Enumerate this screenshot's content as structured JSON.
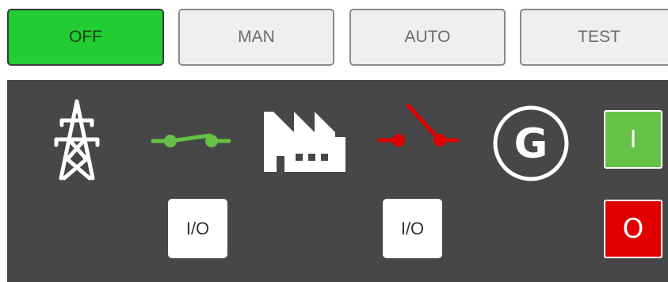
{
  "modes": {
    "off": "OFF",
    "man": "MAN",
    "auto": "AUTO",
    "test": "TEST",
    "active": "OFF"
  },
  "panel": {
    "mains_icon": "power-tower-icon",
    "mains_breaker": {
      "icon": "breaker-closed-icon",
      "state": "closed",
      "color": "#66c247",
      "button_label": "I/O"
    },
    "load_icon": "factory-icon",
    "generator_breaker": {
      "icon": "breaker-open-icon",
      "state": "open",
      "color": "#e00000",
      "button_label": "I/O"
    },
    "generator": {
      "icon": "generator-icon",
      "letter": "G"
    },
    "generator_start_label": "I",
    "generator_stop_label": "O"
  },
  "colors": {
    "active_mode": "#22cc33",
    "panel_bg": "#474747",
    "start_green": "#66c247",
    "stop_red": "#e00000"
  }
}
